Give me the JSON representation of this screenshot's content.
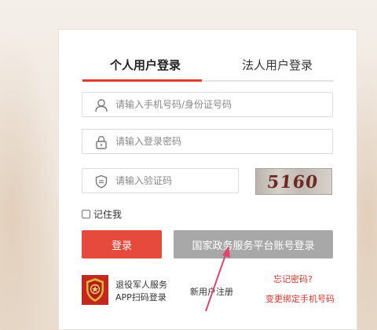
{
  "tabs": [
    {
      "label": "个人用户登录",
      "active": true
    },
    {
      "label": "法人用户登录",
      "active": false
    }
  ],
  "fields": {
    "account_placeholder": "请输入手机号码/身份证号码",
    "password_placeholder": "请输入登录密码",
    "captcha_placeholder": "请输入验证码",
    "account_value": "",
    "password_value": "",
    "captcha_value": ""
  },
  "captcha_image_text": "5160",
  "remember_label": "记住我",
  "buttons": {
    "login": "登录",
    "gov_platform": "国家政务服务平台账号登录"
  },
  "app": {
    "line1": "退役军人服务",
    "line2": "APP扫码登录"
  },
  "links": {
    "new_user": "新用户注册",
    "forgot_password": "忘记密码?",
    "change_phone": "变更绑定手机号码"
  },
  "colors": {
    "accent": "#e54a3d",
    "link_red": "#d9352a",
    "disabled_gray": "#a8a8a8"
  },
  "icons": [
    "user-icon",
    "lock-icon",
    "shield-icon",
    "app-emblem-icon",
    "annotation-arrow"
  ]
}
